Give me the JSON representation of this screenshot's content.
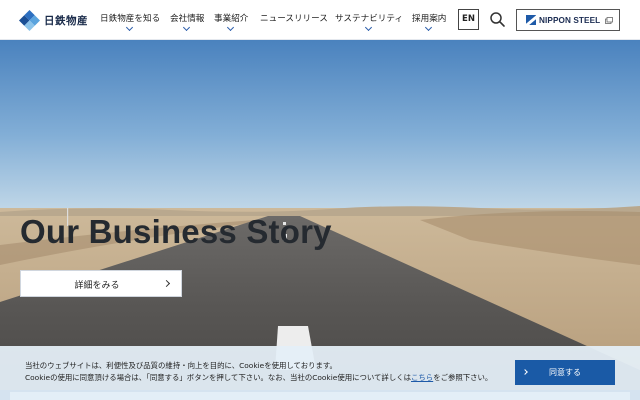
{
  "header": {
    "logo_text": "日鉄物産",
    "nav": [
      {
        "label": "日鉄物産を知る"
      },
      {
        "label": "会社情報"
      },
      {
        "label": "事業紹介"
      },
      {
        "label": "ニュースリリース"
      },
      {
        "label": "サステナビリティ"
      },
      {
        "label": "採用案内"
      }
    ],
    "lang_label": "EN",
    "nippon_steel_label": "NIPPON STEEL",
    "icons": {
      "search": "search-icon",
      "external": "external-link-icon",
      "logo": "diamond-logo-icon"
    }
  },
  "hero": {
    "title": "Our Business Story",
    "detail_button_label": "詳細をみる"
  },
  "cookie": {
    "line1": "当社のウェブサイトは、利便性及び品質の維持・向上を目的に、Cookieを使用しております。",
    "line2_before": "Cookieの使用に同意頂ける場合は、「同意する」ボタンを押して下さい。なお、当社のCookie使用について詳しくは",
    "link_text": "こちら",
    "line2_after": "をご参照下さい。",
    "agree_label": "同意する"
  },
  "colors": {
    "accent": "#1a5aa6",
    "brand_navy": "#1b2c52",
    "cookie_bg": "#e4eff8"
  }
}
